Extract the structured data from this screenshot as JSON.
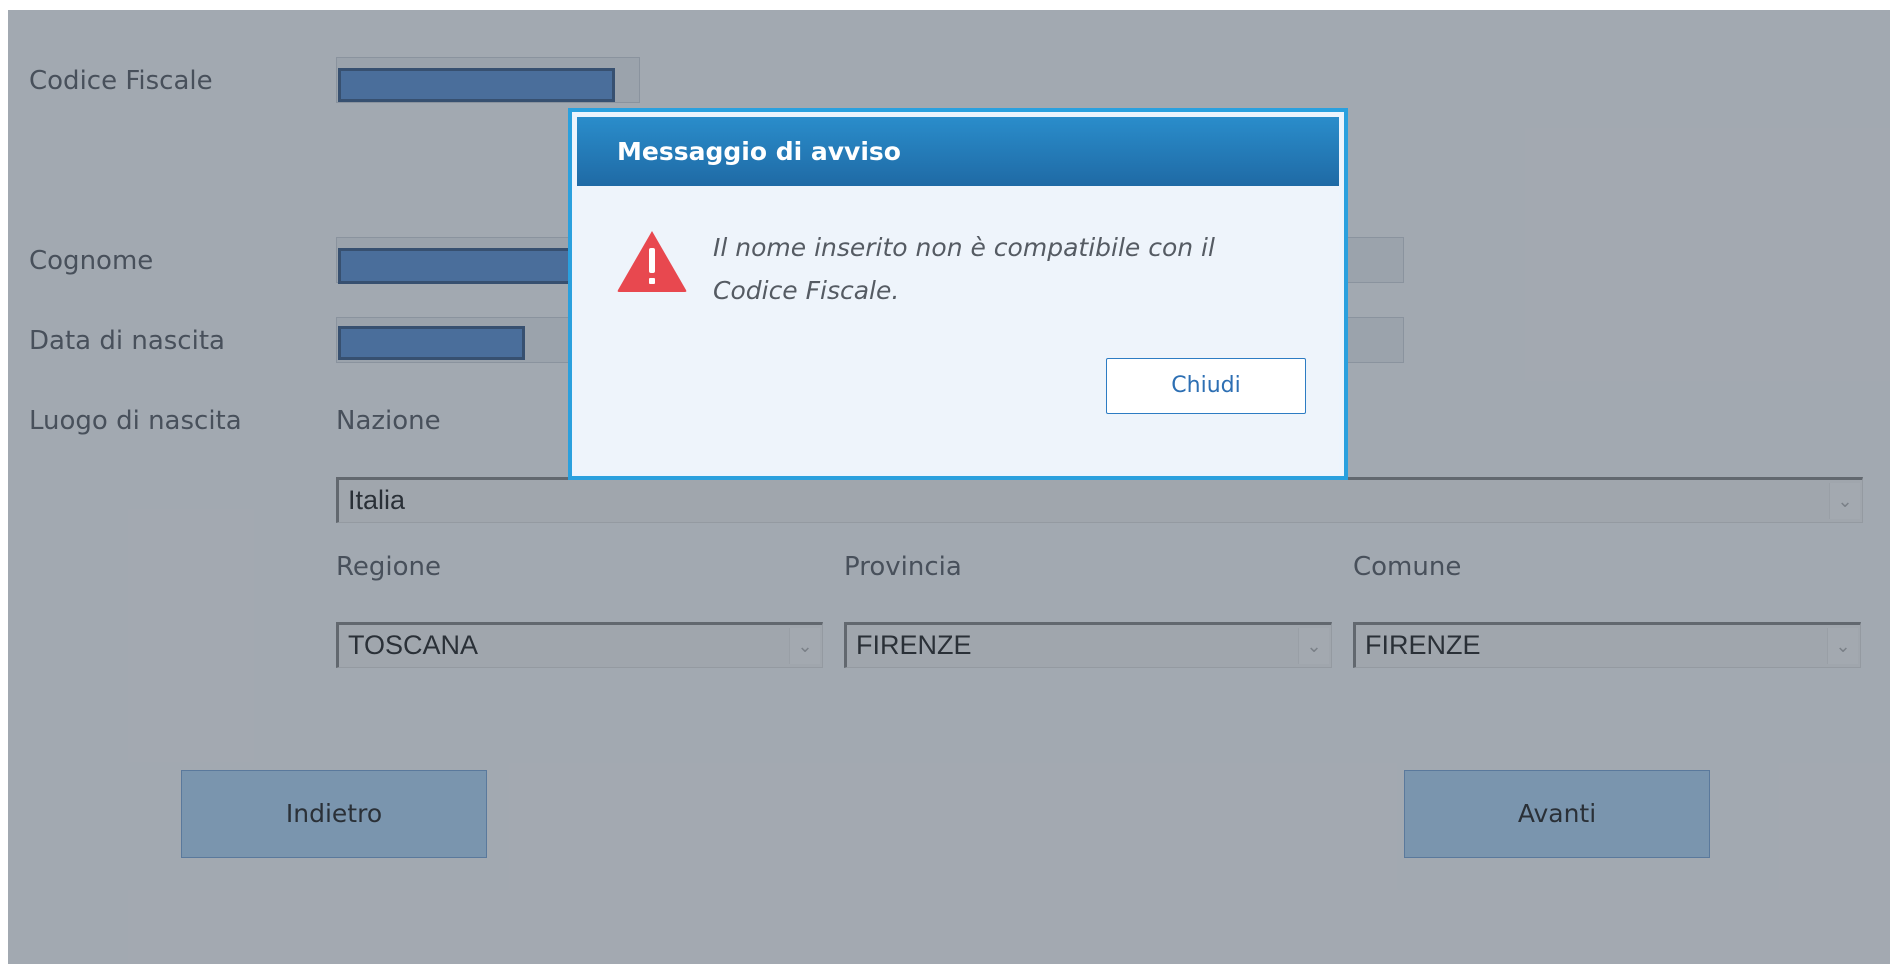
{
  "form": {
    "codice_fiscale_label": "Codice Fiscale",
    "cognome_label": "Cognome",
    "data_nascita_label": "Data di nascita",
    "luogo_nascita_label": "Luogo di nascita",
    "nazione_label": "Nazione",
    "nazione_value": "Italia",
    "regione_label": "Regione",
    "regione_value": "TOSCANA",
    "provincia_label": "Provincia",
    "provincia_value": "FIRENZE",
    "comune_label": "Comune",
    "comune_value": "FIRENZE",
    "back_label": "Indietro",
    "next_label": "Avanti"
  },
  "dialog": {
    "title": "Messaggio di avviso",
    "message": "Il nome inserito non è compatibile con il Codice Fiscale.",
    "close_label": "Chiudi",
    "icon": "warning-icon"
  },
  "colors": {
    "dialog_header": "#1f6aa5",
    "dialog_border": "#2aa0de",
    "warning_red": "#e8484f",
    "button_blue": "#a9d0f1"
  }
}
